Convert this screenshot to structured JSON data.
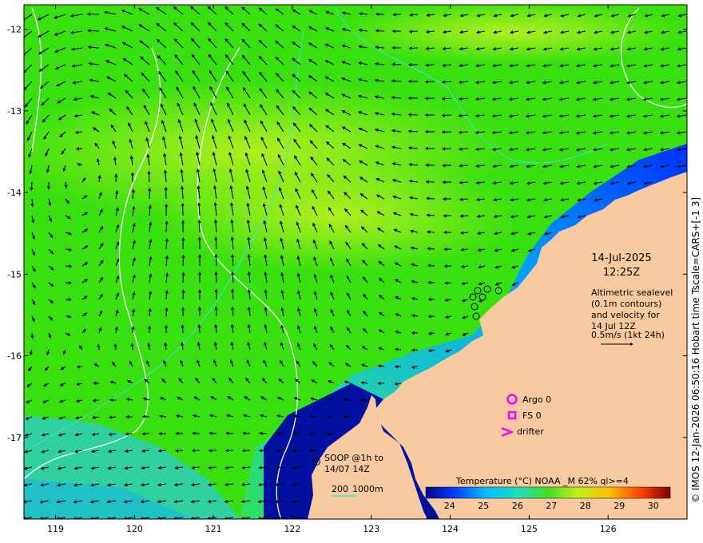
{
  "map": {
    "datetime": "14-Jul-2025",
    "time": "12:25Z",
    "altimetry_note": [
      "Altimetric sealevel",
      "(0.1m contours)",
      "and velocity for",
      "14 Jul 12Z"
    ],
    "velocity_scale_label": "0.5m/s (1kt 24h)",
    "legend": {
      "argo": "Argo 0",
      "fs": "FS 0",
      "drifter": "drifter",
      "argo_color": "#ff00ff"
    },
    "soop_label": [
      "SOOP @1h to",
      "14/07 14Z"
    ],
    "bathymetry": {
      "label_200": "200",
      "label_1000": "1000m",
      "color": "#40e0e0"
    },
    "colorbar": {
      "title": "Temperature (°C) NOAA _M 62% ql>=4",
      "ticks": [
        "24",
        "25",
        "26",
        "27",
        "28",
        "29",
        "30"
      ],
      "vmin": 23.3,
      "vmax": 30.5
    },
    "x_ticks": [
      "119",
      "120",
      "121",
      "122",
      "123",
      "124",
      "125",
      "126"
    ],
    "y_ticks": [
      "-12",
      "-13",
      "-14",
      "-15",
      "-16",
      "-17"
    ],
    "xlim": [
      118.6,
      127.0
    ],
    "ylim": [
      -18.0,
      -11.7
    ],
    "credit": "© IMOS 12-Jan-2026 06:50:16 Hobart time Tscale=CARS+[-1 3]",
    "land_color": "#f9c9a0",
    "deep_sea_color": "#39e010"
  }
}
